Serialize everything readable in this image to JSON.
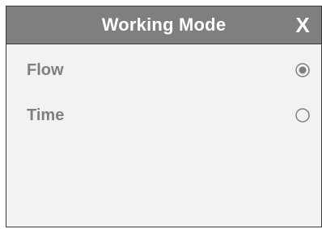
{
  "dialog": {
    "title": "Working Mode",
    "close_label": "X"
  },
  "options": [
    {
      "label": "Flow",
      "selected": true
    },
    {
      "label": "Time",
      "selected": false
    }
  ],
  "colors": {
    "titlebar": "#7f7f7f",
    "body": "#f2f2f2",
    "text": "#7f7f7f",
    "title_text": "#ffffff"
  },
  "icons": {
    "selected": "radio-selected-icon",
    "unselected": "radio-unselected-icon"
  }
}
